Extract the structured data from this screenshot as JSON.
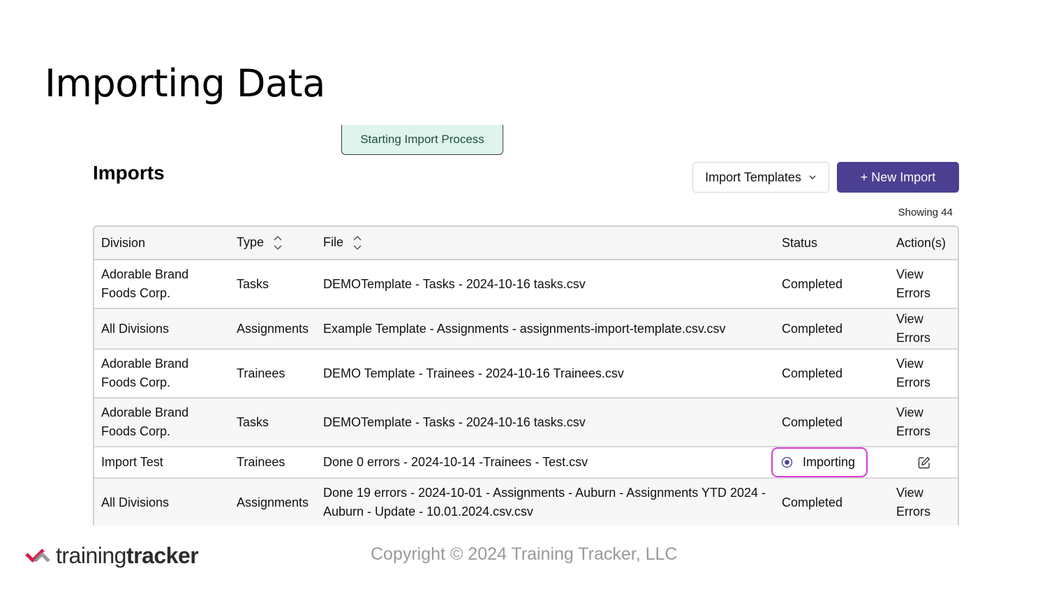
{
  "slide": {
    "title": "Importing Data"
  },
  "toast": {
    "text": "Starting Import Process"
  },
  "imports": {
    "title": "Imports",
    "templates_button": "Import Templates",
    "new_button": "+ New Import",
    "showing": "Showing 44"
  },
  "table": {
    "headers": {
      "division": "Division",
      "type": "Type",
      "file": "File",
      "status": "Status",
      "actions": "Action(s)"
    },
    "rows": [
      {
        "division": "Adorable Brand Foods Corp.",
        "type": "Tasks",
        "file": "DEMOTemplate - Tasks - 2024-10-16 tasks.csv",
        "status": "Completed",
        "action": "View Errors"
      },
      {
        "division": "All Divisions",
        "type": "Assignments",
        "file": "Example Template - Assignments - assignments-import-template.csv.csv",
        "status": "Completed",
        "action": "View Errors"
      },
      {
        "division": "Adorable Brand Foods Corp.",
        "type": "Trainees",
        "file": "DEMO Template - Trainees - 2024-10-16 Trainees.csv",
        "status": "Completed",
        "action": "View Errors"
      },
      {
        "division": "Adorable Brand Foods Corp.",
        "type": "Tasks",
        "file": "DEMOTemplate - Tasks - 2024-10-16 tasks.csv",
        "status": "Completed",
        "action": "View Errors"
      },
      {
        "division": "Import Test",
        "type": "Trainees",
        "file": "Done 0 errors - 2024-10-14 -Trainees - Test.csv",
        "status": "Importing",
        "action_icon": "edit-icon"
      },
      {
        "division": "All Divisions",
        "type": "Assignments",
        "file": "Done 19 errors - 2024-10-01 - Assignments - Auburn - Assignments YTD 2024 - Auburn - Update - 10.01.2024.csv.csv",
        "status": "Completed",
        "action": "View Errors"
      }
    ]
  },
  "footer": {
    "logo_light": "training",
    "logo_bold": "tracker",
    "copyright": "Copyright © 2024 Training Tracker, LLC"
  },
  "colors": {
    "primary_button": "#4b3f91",
    "toast_bg": "#dff4ec",
    "highlight": "#d63ad8",
    "logo_red": "#d21f4e",
    "logo_gray": "#8a8a8a"
  }
}
